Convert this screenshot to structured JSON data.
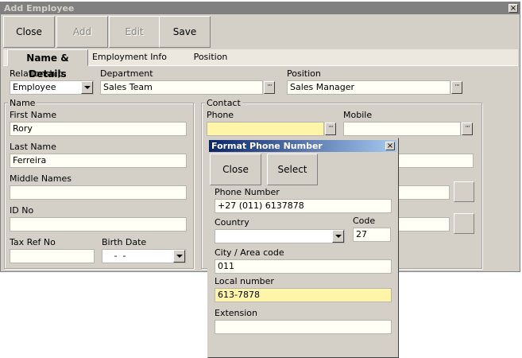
{
  "window": {
    "title": "Add Employee",
    "close_glyph": "×"
  },
  "toolbar": {
    "close": "Close",
    "add": "Add",
    "edit": "Edit",
    "save": "Save"
  },
  "tabs": {
    "details": "Name & Details",
    "employment": "Employment Info",
    "position": "Position"
  },
  "relationship": {
    "label": "Relationship",
    "value": "Employee"
  },
  "department": {
    "label": "Department",
    "value": "Sales Team"
  },
  "position": {
    "label": "Position",
    "value": "Sales Manager"
  },
  "name_group": {
    "title": "Name",
    "first_name": {
      "label": "First Name",
      "value": "Rory"
    },
    "last_name": {
      "label": "Last Name",
      "value": "Ferreira"
    },
    "middle_names": {
      "label": "Middle Names",
      "value": ""
    },
    "id_no": {
      "label": "ID No",
      "value": ""
    },
    "tax_ref_no": {
      "label": "Tax Ref No",
      "value": ""
    },
    "birth_date": {
      "label": "Birth Date",
      "value": " -  - "
    }
  },
  "contact_group": {
    "title": "Contact",
    "phone": {
      "label": "Phone",
      "value": ""
    },
    "mobile": {
      "label": "Mobile",
      "value": ""
    }
  },
  "ellipsis": "···",
  "dialog": {
    "title": "Format Phone Number",
    "close_glyph": "×",
    "close": "Close",
    "select": "Select",
    "phone_number": {
      "label": "Phone Number",
      "value": "+27 (011) 6137878"
    },
    "country": {
      "label": "Country",
      "value": ""
    },
    "code": {
      "label": "Code",
      "value": "27"
    },
    "city": {
      "label": "City / Area code",
      "value": "011"
    },
    "local": {
      "label": "Local number",
      "value": "613-7878"
    },
    "extension": {
      "label": "Extension",
      "value": ""
    }
  },
  "colors": {
    "field_bg": "#fffff6",
    "highlight_field": "#fff5a8",
    "dialog_title_start": "#0a246a",
    "window_face": "#d4d0c8"
  }
}
